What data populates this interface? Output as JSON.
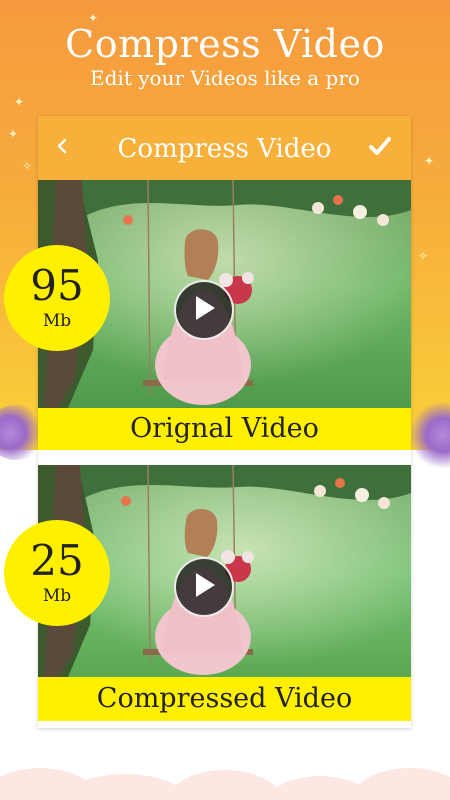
{
  "hero": {
    "title": "Compress Video",
    "subtitle": "Edit your Videos like a pro"
  },
  "toolbar": {
    "title": "Compress Video",
    "back_icon": "chevron-left-icon",
    "confirm_icon": "check-icon"
  },
  "videos": [
    {
      "caption": "Orignal Video",
      "size_value": "95",
      "size_unit": "Mb"
    },
    {
      "caption": "Compressed Video",
      "size_value": "25",
      "size_unit": "Mb"
    }
  ],
  "colors": {
    "header_gradient_top": "#f59a3e",
    "header_gradient_bottom": "#fbd23a",
    "toolbar": "#f7b13b",
    "caption_bar": "#fff000",
    "badge": "#fff000",
    "play_button": "#141414"
  }
}
